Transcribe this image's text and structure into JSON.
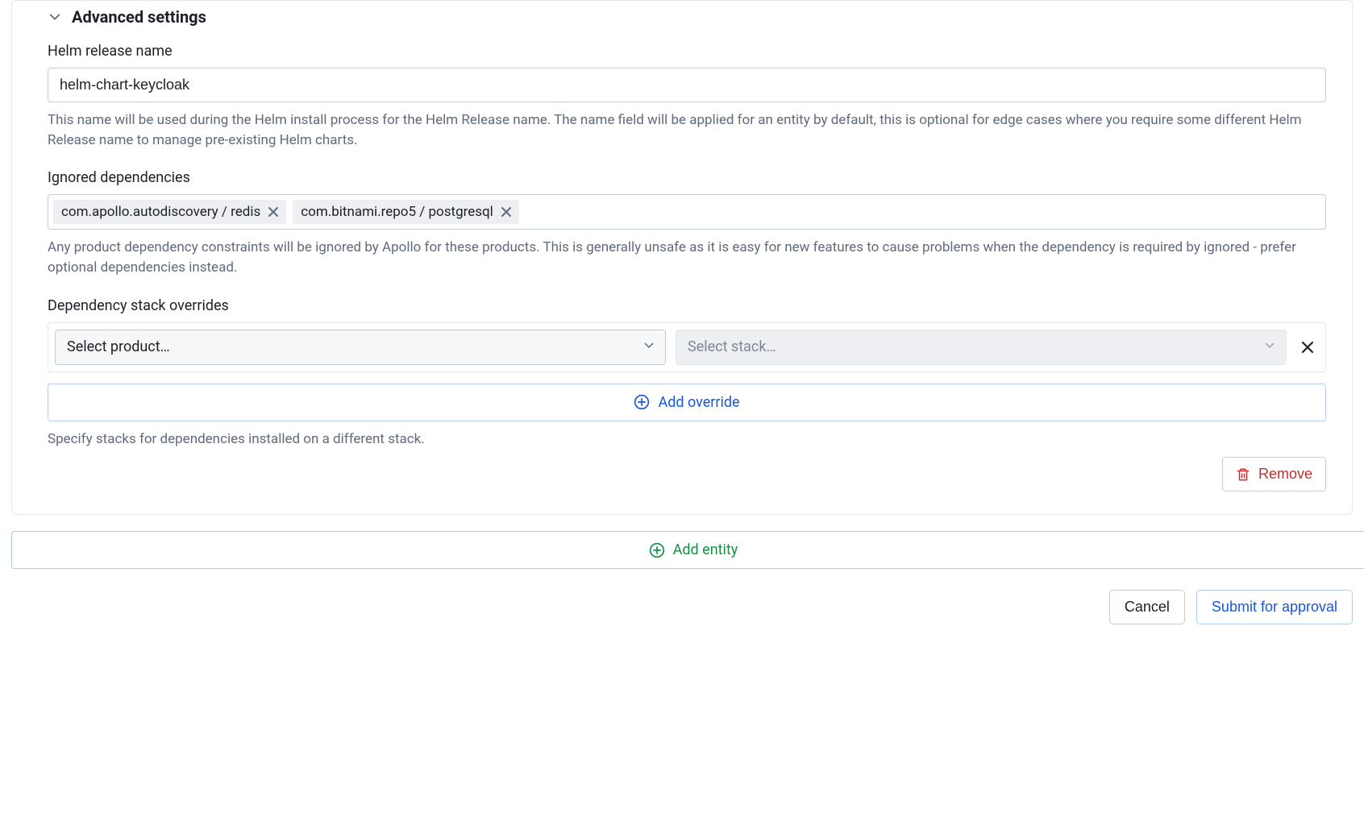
{
  "advanced": {
    "title": "Advanced settings",
    "helm": {
      "label": "Helm release name",
      "value": "helm-chart-keycloak",
      "help": "This name will be used during the Helm install process for the Helm Release name. The name field will be applied for an entity by default, this is optional for edge cases where you require some different Helm Release name to manage pre-existing Helm charts."
    },
    "ignored": {
      "label": "Ignored dependencies",
      "tags": [
        "com.apollo.autodiscovery / redis",
        "com.bitnami.repo5 / postgresql"
      ],
      "help": "Any product dependency constraints will be ignored by Apollo for these products. This is generally unsafe as it is easy for new features to cause problems when the dependency is required by ignored - prefer optional dependencies instead."
    },
    "overrides": {
      "label": "Dependency stack overrides",
      "product_placeholder": "Select product…",
      "stack_placeholder": "Select stack…",
      "add_label": "Add override",
      "help": "Specify stacks for dependencies installed on a different stack."
    },
    "remove_label": "Remove"
  },
  "add_entity_label": "Add entity",
  "footer": {
    "cancel": "Cancel",
    "submit": "Submit for approval"
  }
}
